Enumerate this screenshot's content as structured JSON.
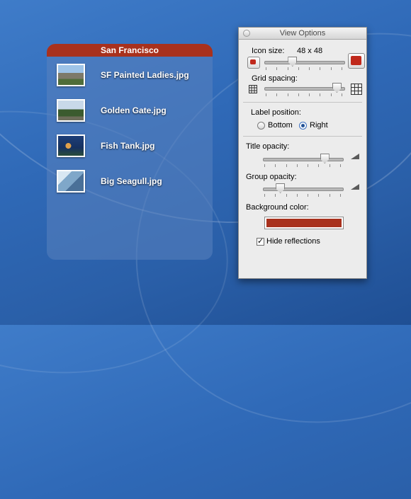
{
  "group": {
    "title": "San Francisco",
    "header_color": "#a8311d",
    "files": [
      {
        "name": "SF Painted Ladies.jpg",
        "icon": "photo-thumbnail-icon"
      },
      {
        "name": "Golden Gate.jpg",
        "icon": "photo-thumbnail-icon"
      },
      {
        "name": "Fish Tank.jpg",
        "icon": "photo-thumbnail-icon"
      },
      {
        "name": "Big Seagull.jpg",
        "icon": "photo-thumbnail-icon"
      }
    ]
  },
  "view_options": {
    "title": "View Options",
    "icon_size": {
      "label": "Icon size:",
      "value": "48 x 48",
      "level": 0.33
    },
    "grid_spacing": {
      "label": "Grid spacing:",
      "level": 0.95
    },
    "label_position": {
      "label": "Label position:",
      "options": [
        "Bottom",
        "Right"
      ],
      "selected": "Right"
    },
    "title_opacity": {
      "label": "Title opacity:",
      "level": 0.8
    },
    "group_opacity": {
      "label": "Group opacity:",
      "level": 0.18
    },
    "background_color": {
      "label": "Background color:",
      "value": "#a8311d"
    },
    "hide_reflections": {
      "label": "Hide reflections",
      "checked": true
    }
  }
}
